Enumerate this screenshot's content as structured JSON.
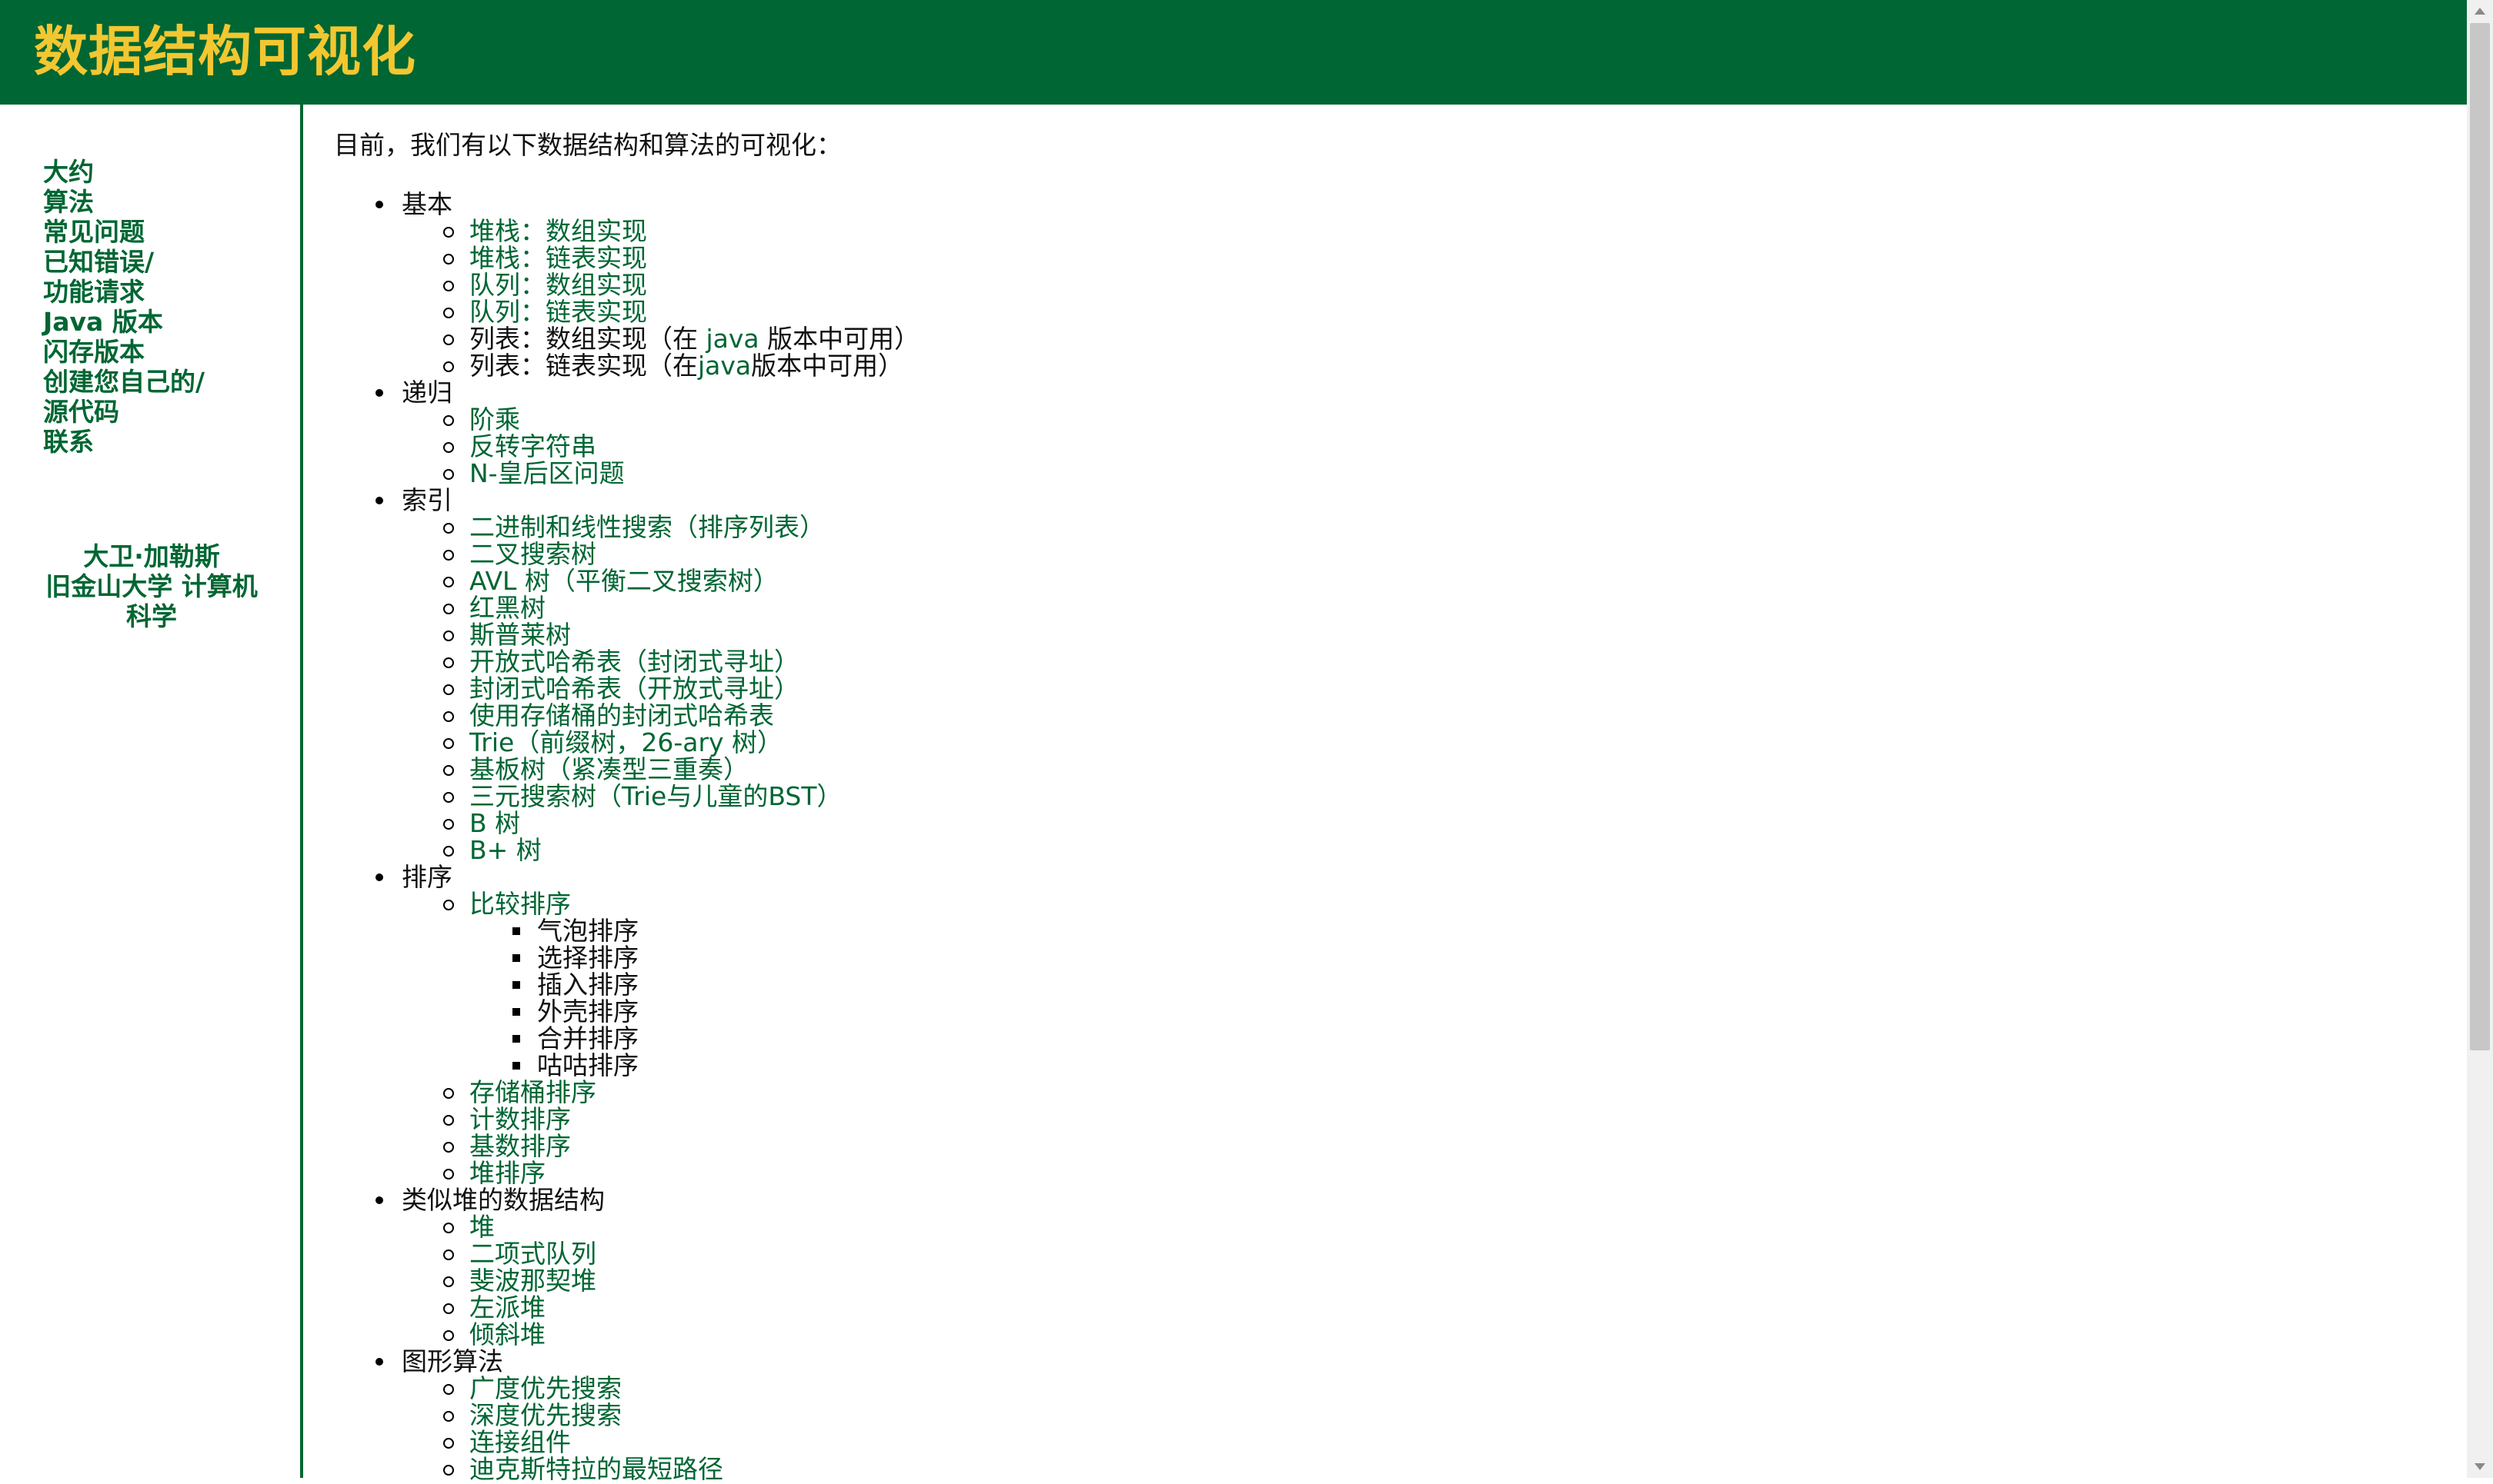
{
  "header": {
    "title": "数据结构可视化"
  },
  "sidebar": {
    "nav": [
      "大约",
      "算法",
      "常见问题",
      "已知错误/",
      "功能请求",
      "Java 版本",
      "闪存版本",
      "创建您自己的/",
      "源代码",
      "联系"
    ],
    "author": {
      "name": "大卫·加勒斯",
      "school": "旧金山大学 计算机",
      "dept": "科学"
    }
  },
  "main": {
    "intro": "目前，我们有以下数据结构和算法的可视化：",
    "sections": [
      {
        "label": "基本",
        "items": [
          {
            "text": "堆栈：数组实现"
          },
          {
            "text": "堆栈：链表实现"
          },
          {
            "text": "队列：数组实现"
          },
          {
            "text": "队列：链表实现"
          },
          {
            "text_prefix": "列表：数组实现（在 ",
            "link": "java",
            "text_suffix": " 版本中可用）"
          },
          {
            "text_prefix": "列表：链表实现（在",
            "link": "java",
            "text_suffix": "版本中可用）"
          }
        ]
      },
      {
        "label": "递归",
        "items": [
          {
            "text": "阶乘"
          },
          {
            "text": "反转字符串"
          },
          {
            "text": "N-皇后区问题"
          }
        ]
      },
      {
        "label": "索引",
        "items": [
          {
            "text": "二进制和线性搜索（排序列表）"
          },
          {
            "text": "二叉搜索树"
          },
          {
            "text": "AVL 树（平衡二叉搜索树）"
          },
          {
            "text": "红黑树"
          },
          {
            "text": "斯普莱树"
          },
          {
            "text": "开放式哈希表（封闭式寻址）"
          },
          {
            "text": "封闭式哈希表（开放式寻址）"
          },
          {
            "text": "使用存储桶的封闭式哈希表"
          },
          {
            "text": "Trie（前缀树，26-ary 树）"
          },
          {
            "text": "基板树（紧凑型三重奏）"
          },
          {
            "text": "三元搜索树（Trie与儿童的BST）"
          },
          {
            "text": "B 树"
          },
          {
            "text": "B+ 树"
          }
        ]
      },
      {
        "label": "排序",
        "items": [
          {
            "text": "比较排序",
            "children": [
              "气泡排序",
              "选择排序",
              "插入排序",
              "外壳排序",
              "合并排序",
              "咕咕排序"
            ]
          },
          {
            "text": "存储桶排序"
          },
          {
            "text": "计数排序"
          },
          {
            "text": "基数排序"
          },
          {
            "text": "堆排序"
          }
        ]
      },
      {
        "label": "类似堆的数据结构",
        "items": [
          {
            "text": "堆"
          },
          {
            "text": "二项式队列"
          },
          {
            "text": "斐波那契堆"
          },
          {
            "text": "左派堆"
          },
          {
            "text": "倾斜堆"
          }
        ]
      },
      {
        "label": "图形算法",
        "items": [
          {
            "text": "广度优先搜索"
          },
          {
            "text": "深度优先搜索"
          },
          {
            "text": "连接组件"
          },
          {
            "text": "迪克斯特拉的最短路径"
          }
        ]
      }
    ]
  },
  "colors": {
    "brand_green": "#006633",
    "title_gold": "#f2c731"
  }
}
